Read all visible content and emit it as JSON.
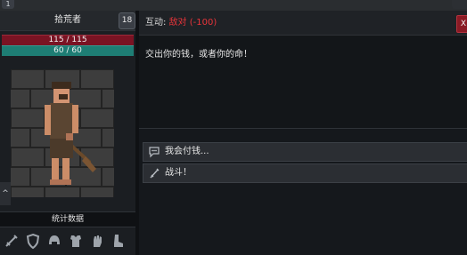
{
  "top": {
    "corner_badge": "1"
  },
  "character": {
    "name": "拾荒者",
    "level": "18",
    "hp_text": "115 / 115",
    "mp_text": "60 / 60"
  },
  "stats": {
    "header": "统计数据"
  },
  "collapse": {
    "symbol": "^"
  },
  "interaction": {
    "label": "互动: ",
    "status": "敌对 (-100)",
    "close": "X"
  },
  "dialog": {
    "text": "交出你的钱，或者你的命！"
  },
  "options": [
    {
      "text": "我会付钱...",
      "icon": "speech-bubble-icon"
    },
    {
      "text": "战斗！",
      "icon": "sword-icon"
    }
  ],
  "slots": [
    "sword-icon",
    "shield-icon",
    "helmet-icon",
    "armor-icon",
    "gauntlets-icon",
    "boots-icon"
  ],
  "colors": {
    "hostile": "#e8343a",
    "hp": "#7a1323",
    "mp": "#1e7d74"
  }
}
